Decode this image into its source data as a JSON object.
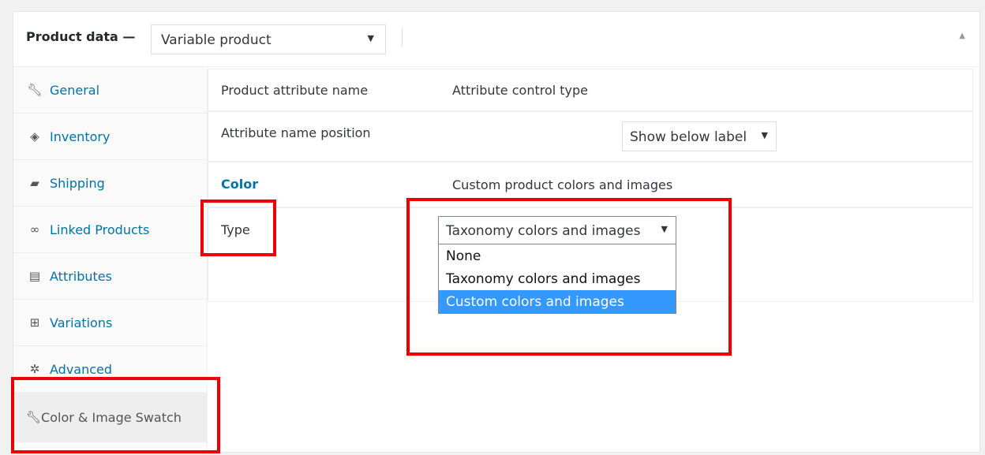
{
  "header": {
    "title": "Product data —",
    "product_type": "Variable product",
    "collapse_icon": "triangle-up-icon"
  },
  "sidebar": {
    "items": [
      {
        "label": "General",
        "icon": "wrench-icon"
      },
      {
        "label": "Inventory",
        "icon": "tag-icon"
      },
      {
        "label": "Shipping",
        "icon": "truck-icon"
      },
      {
        "label": "Linked Products",
        "icon": "link-icon"
      },
      {
        "label": "Attributes",
        "icon": "list-icon"
      },
      {
        "label": "Variations",
        "icon": "grid-icon"
      },
      {
        "label": "Advanced",
        "icon": "gear-icon"
      },
      {
        "label": "Color & Image Swatch",
        "icon": "wrench-icon",
        "active": true
      }
    ]
  },
  "table": {
    "col1_header": "Product attribute name",
    "col2_header": "Attribute control type",
    "position_label": "Attribute name position",
    "position_value": "Show below label",
    "attribute_name": "Color",
    "attribute_control": "Custom product colors and images",
    "type_label": "Type",
    "type_value": "Taxonomy colors and images"
  },
  "dropdown": {
    "options": [
      "None",
      "Taxonomy colors and images",
      "Custom colors and images"
    ],
    "highlighted": "Custom colors and images"
  },
  "colors": {
    "link": "#0073aa",
    "highlight": "#3399ff",
    "annotation": "#ee0000"
  }
}
